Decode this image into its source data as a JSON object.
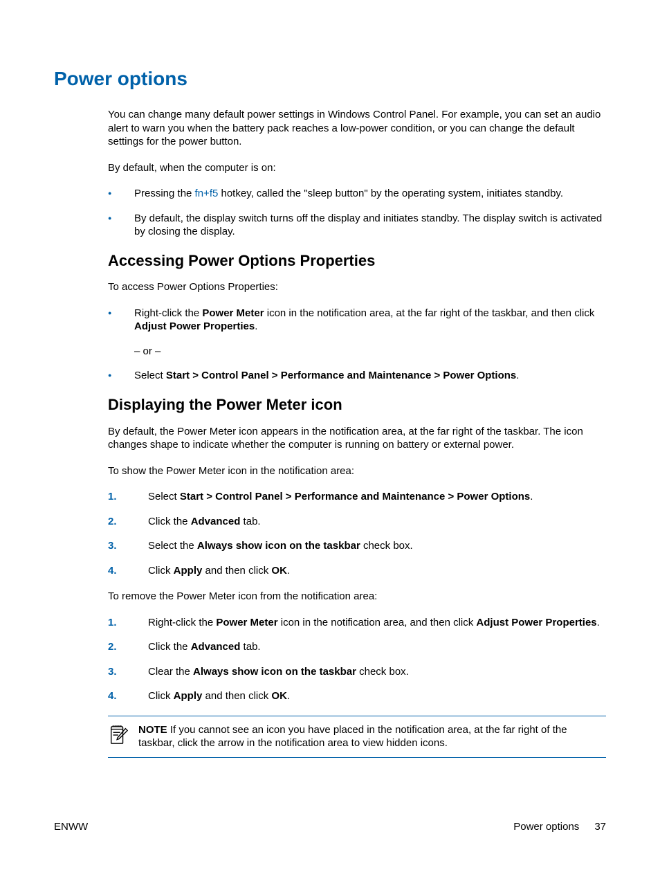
{
  "heading": "Power options",
  "intro_p1": "You can change many default power settings in Windows Control Panel. For example, you can set an audio alert to warn you when the battery pack reaches a low-power condition, or you can change the default settings for the power button.",
  "intro_p2": "By default, when the computer is on:",
  "intro_bullets": {
    "b1_pre": "Pressing the ",
    "b1_link": "fn+f5",
    "b1_post": " hotkey, called the \"sleep button\" by the operating system, initiates standby.",
    "b2": "By default, the display switch turns off the display and initiates standby. The display switch is activated by closing the display."
  },
  "section1": {
    "heading": "Accessing Power Options Properties",
    "intro": "To access Power Options Properties:",
    "b1_pre": "Right-click the ",
    "b1_bold1": "Power Meter",
    "b1_mid": " icon in the notification area, at the far right of the taskbar, and then click ",
    "b1_bold2": "Adjust Power Properties",
    "b1_post": ".",
    "or": "– or –",
    "b2_pre": "Select ",
    "b2_bold": "Start > Control Panel > Performance and Maintenance > Power Options",
    "b2_post": "."
  },
  "section2": {
    "heading": "Displaying the Power Meter icon",
    "intro": "By default, the Power Meter icon appears in the notification area, at the far right of the taskbar. The icon changes shape to indicate whether the computer is running on battery or external power.",
    "show_intro": "To show the Power Meter icon in the notification area:",
    "show_steps": {
      "s1_pre": "Select ",
      "s1_bold": "Start > Control Panel > Performance and Maintenance > Power Options",
      "s1_post": ".",
      "s2_pre": "Click the ",
      "s2_bold": "Advanced",
      "s2_post": " tab.",
      "s3_pre": "Select the ",
      "s3_bold": "Always show icon on the taskbar",
      "s3_post": " check box.",
      "s4_pre": "Click ",
      "s4_bold1": "Apply",
      "s4_mid": " and then click ",
      "s4_bold2": "OK",
      "s4_post": "."
    },
    "remove_intro": "To remove the Power Meter icon from the notification area:",
    "remove_steps": {
      "s1_pre": "Right-click the ",
      "s1_bold1": "Power Meter",
      "s1_mid": " icon in the notification area, and then click ",
      "s1_bold2": "Adjust Power Properties",
      "s1_post": ".",
      "s2_pre": "Click the ",
      "s2_bold": "Advanced",
      "s2_post": " tab.",
      "s3_pre": "Clear the ",
      "s3_bold": "Always show icon on the taskbar",
      "s3_post": " check box.",
      "s4_pre": "Click ",
      "s4_bold1": "Apply",
      "s4_mid": " and then click ",
      "s4_bold2": "OK",
      "s4_post": "."
    },
    "note_label": "NOTE",
    "note_text": "   If you cannot see an icon you have placed in the notification area, at the far right of the taskbar, click the arrow in the notification area to view hidden icons."
  },
  "footer": {
    "left": "ENWW",
    "right_label": "Power options",
    "page_num": "37"
  }
}
